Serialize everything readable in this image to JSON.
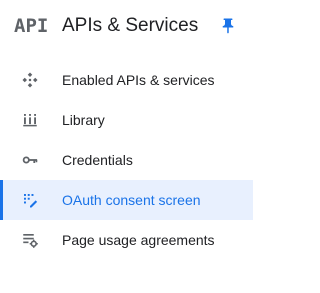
{
  "header": {
    "logo_text": "API",
    "title": "APIs & Services",
    "pin_icon": "pin-icon"
  },
  "nav": {
    "items": [
      {
        "label": "Enabled APIs & services",
        "icon": "enabled-apis-icon",
        "active": false
      },
      {
        "label": "Library",
        "icon": "library-icon",
        "active": false
      },
      {
        "label": "Credentials",
        "icon": "key-icon",
        "active": false
      },
      {
        "label": "OAuth consent screen",
        "icon": "oauth-consent-icon",
        "active": true
      },
      {
        "label": "Page usage agreements",
        "icon": "page-usage-settings-icon",
        "active": false
      }
    ]
  },
  "colors": {
    "accent": "#1a73e8",
    "active_bg": "#e8f0fe",
    "text": "#202124",
    "icon": "#5f6368"
  }
}
